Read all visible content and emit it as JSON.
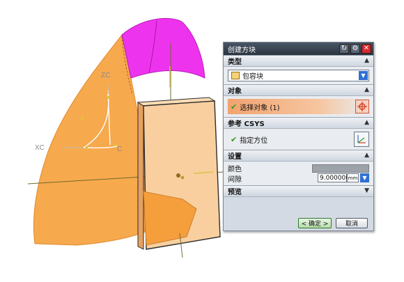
{
  "viewport": {
    "axis_labels": {
      "zc": "ZC",
      "xc": "XC",
      "yc": "C"
    }
  },
  "dialog": {
    "title": "创建方块",
    "titlebar_icons": [
      "refresh-icon",
      "gear-icon",
      "close-icon"
    ],
    "sections": {
      "type": {
        "header": "类型",
        "selected": "包容块"
      },
      "object": {
        "header": "对象",
        "select_label": "选择对象 (1)"
      },
      "ref_csys": {
        "header": "参考 CSYS",
        "specify_label": "指定方位"
      },
      "settings": {
        "header": "设置",
        "color_label": "颜色",
        "gap_label": "间隙",
        "gap_value": "9.000000",
        "gap_unit": "mm"
      },
      "preview": {
        "header": "预览"
      }
    },
    "buttons": {
      "ok": "< 确定 >",
      "cancel": "取消"
    }
  },
  "colors": {
    "orange_surface": "#f7a94d",
    "magenta_surface": "#ee33ee",
    "block_fill": "#f9cf9f",
    "accent_blue": "#2f6fd3"
  }
}
